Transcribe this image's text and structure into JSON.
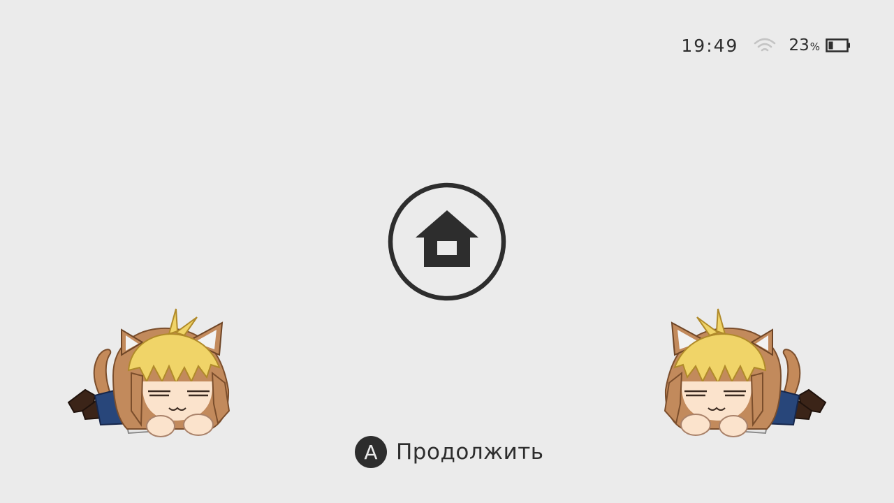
{
  "status_bar": {
    "time": "19:49",
    "battery_percent": "23",
    "battery_percent_sign": "%",
    "battery_level": 0.23,
    "wifi_icon": "wifi-icon",
    "battery_icon": "battery-icon"
  },
  "home": {
    "icon": "home-icon"
  },
  "prompt": {
    "button_glyph": "A",
    "label": "Продолжить"
  },
  "colors": {
    "background": "#ebebeb",
    "foreground": "#2d2d2d",
    "wifi_inactive": "#b8b8b8"
  }
}
